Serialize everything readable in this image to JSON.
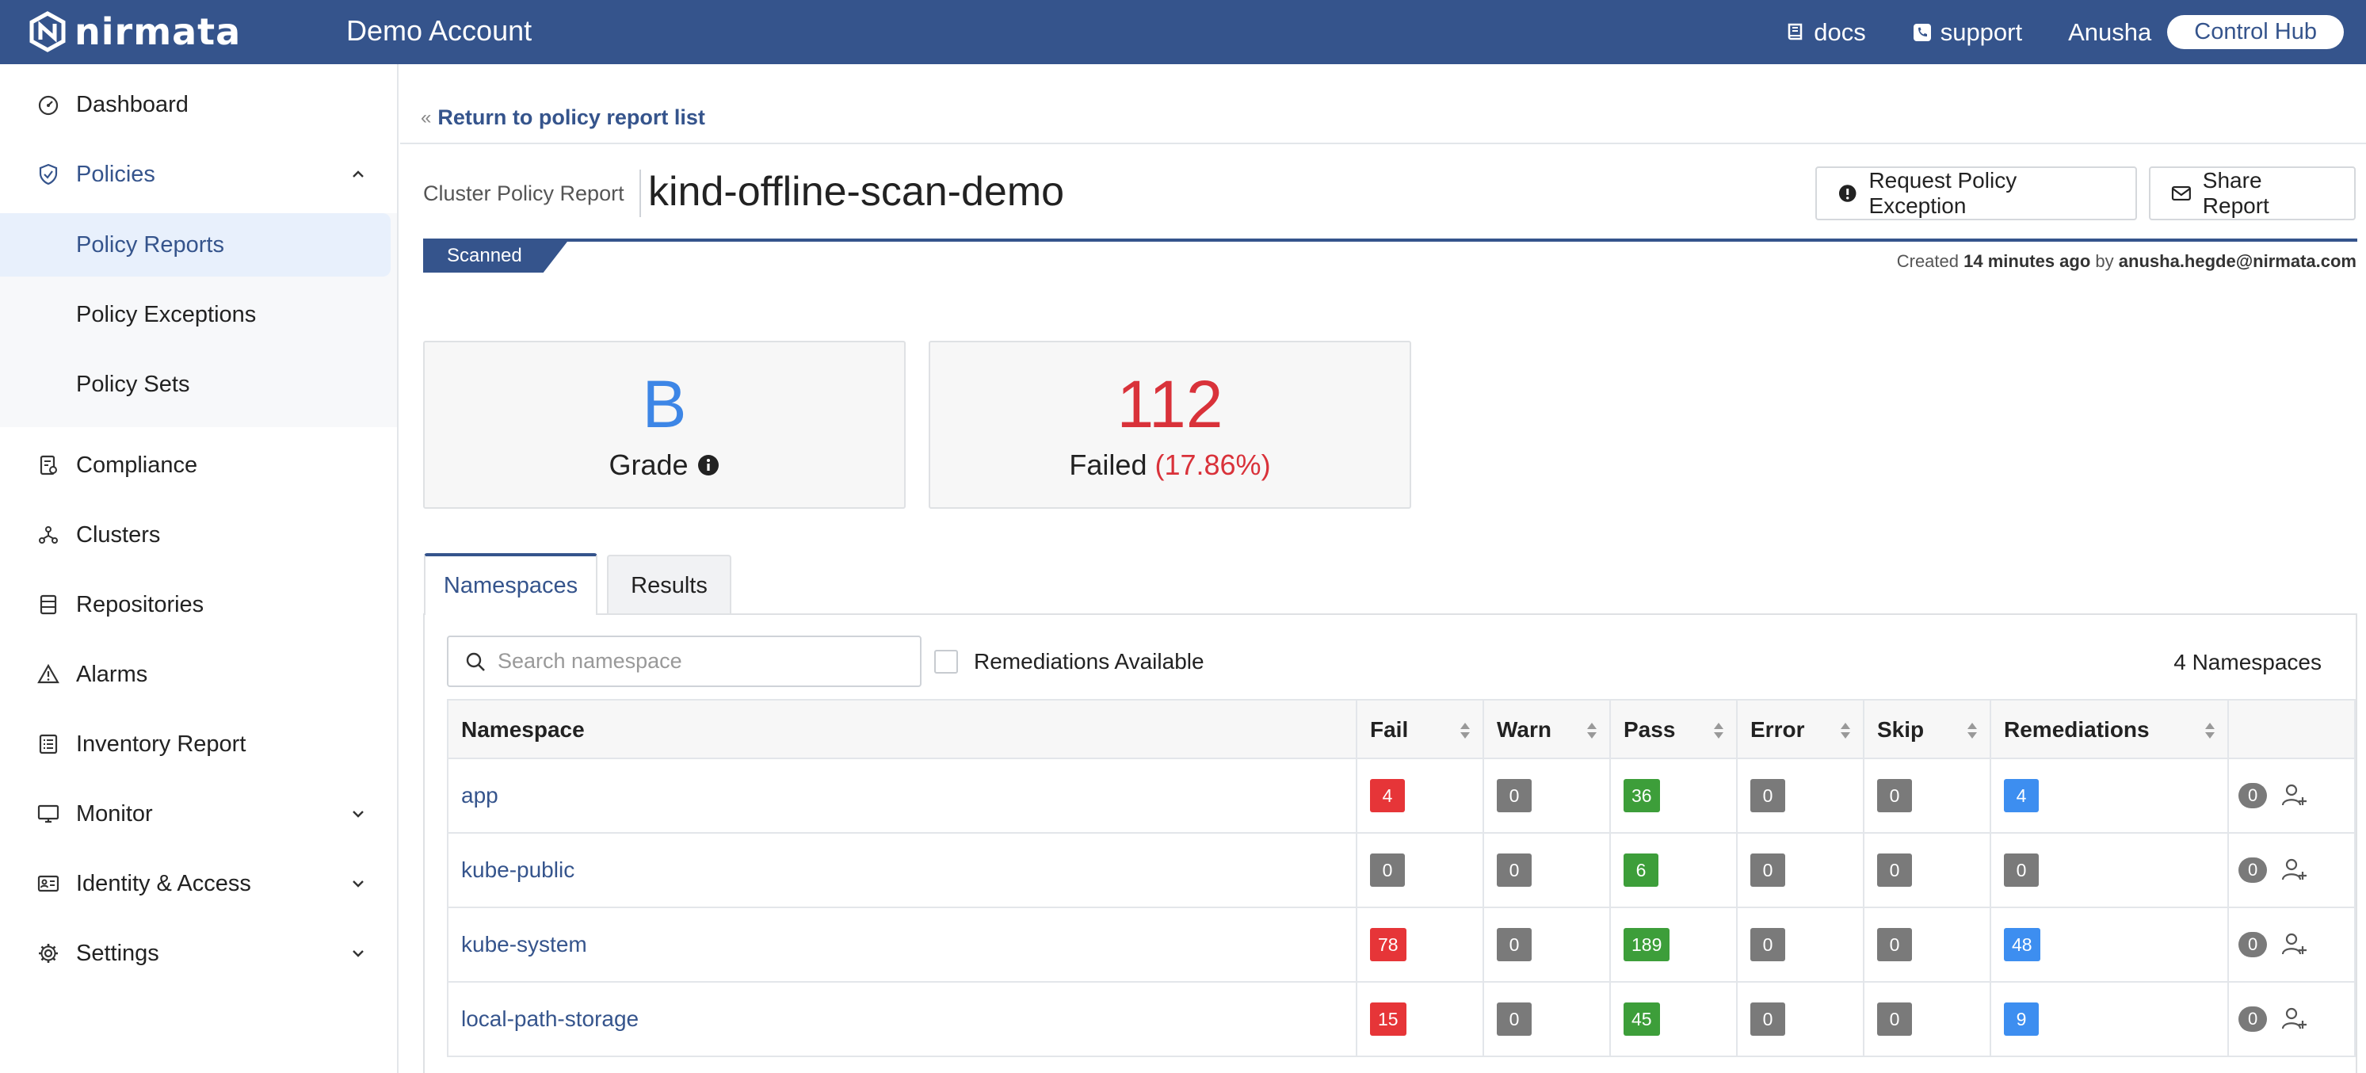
{
  "topbar": {
    "logo_text": "nirmata",
    "account": "Demo Account",
    "docs": "docs",
    "support": "support",
    "user": "Anusha",
    "control_hub": "Control Hub"
  },
  "sidebar": {
    "items": [
      {
        "label": "Dashboard",
        "icon": "dashboard-icon"
      },
      {
        "label": "Policies",
        "icon": "shield-icon"
      },
      {
        "label": "Compliance",
        "icon": "compliance-icon"
      },
      {
        "label": "Clusters",
        "icon": "clusters-icon"
      },
      {
        "label": "Repositories",
        "icon": "repositories-icon"
      },
      {
        "label": "Alarms",
        "icon": "alarm-icon"
      },
      {
        "label": "Inventory Report",
        "icon": "inventory-icon"
      },
      {
        "label": "Monitor",
        "icon": "monitor-icon"
      },
      {
        "label": "Identity & Access",
        "icon": "identity-icon"
      },
      {
        "label": "Settings",
        "icon": "gear-icon"
      }
    ],
    "sub_items": [
      {
        "label": "Policy Reports"
      },
      {
        "label": "Policy Exceptions"
      },
      {
        "label": "Policy Sets"
      }
    ]
  },
  "header": {
    "back_link": "Return to policy report list",
    "title_label": "Cluster Policy Report",
    "title": "kind-offline-scan-demo",
    "request_exception": "Request Policy Exception",
    "share_report": "Share Report",
    "status": "Scanned",
    "created_prefix": "Created",
    "created_time": "14 minutes ago",
    "created_by_word": "by",
    "created_by": "anusha.hegde@nirmata.com"
  },
  "summary": {
    "grade_value": "B",
    "grade_label": "Grade",
    "failed_value": "112",
    "failed_label": "Failed",
    "failed_pct": "(17.86%)"
  },
  "tabs": [
    {
      "label": "Namespaces"
    },
    {
      "label": "Results"
    }
  ],
  "filters": {
    "search_placeholder": "Search namespace",
    "remediations_label": "Remediations Available",
    "count": "4 Namespaces"
  },
  "table": {
    "headers": [
      "Namespace",
      "Fail",
      "Warn",
      "Pass",
      "Error",
      "Skip",
      "Remediations"
    ],
    "rows": [
      {
        "namespace": "app",
        "fail": "4",
        "warn": "0",
        "pass": "36",
        "error": "0",
        "skip": "0",
        "remediations": "4",
        "exceptions": "0"
      },
      {
        "namespace": "kube-public",
        "fail": "0",
        "warn": "0",
        "pass": "6",
        "error": "0",
        "skip": "0",
        "remediations": "0",
        "exceptions": "0"
      },
      {
        "namespace": "kube-system",
        "fail": "78",
        "warn": "0",
        "pass": "189",
        "error": "0",
        "skip": "0",
        "remediations": "48",
        "exceptions": "0"
      },
      {
        "namespace": "local-path-storage",
        "fail": "15",
        "warn": "0",
        "pass": "45",
        "error": "0",
        "skip": "0",
        "remediations": "9",
        "exceptions": "0"
      }
    ]
  },
  "colors": {
    "brand": "#35548c",
    "fail": "#e63538",
    "pass": "#3d9e3a",
    "remediation": "#3d8ef0",
    "neutral": "#7a7a7a"
  }
}
